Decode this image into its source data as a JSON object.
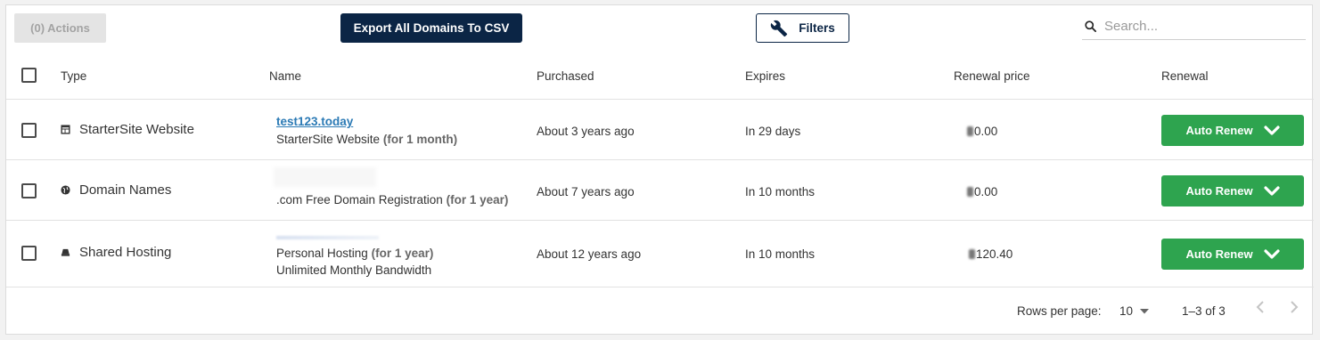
{
  "toolbar": {
    "actions_label": "(0) Actions",
    "export_label": "Export All Domains To CSV",
    "filters_label": "Filters",
    "search_placeholder": "Search..."
  },
  "table": {
    "columns": [
      "Type",
      "Name",
      "Purchased",
      "Expires",
      "Renewal price",
      "Renewal"
    ],
    "rows": [
      {
        "type": "StarterSite Website",
        "type_icon": "website-icon",
        "name_link": "test123.today",
        "name_sub": "StarterSite Website",
        "name_sub_duration": "(for 1 month)",
        "name_sub2": "",
        "purchased": "About 3 years ago",
        "expires": "In 29 days",
        "renewal_price": "0.00",
        "renewal_label": "Auto Renew"
      },
      {
        "type": "Domain Names",
        "type_icon": "globe-icon",
        "name_link": "",
        "name_sub": ".com Free Domain Registration",
        "name_sub_duration": "(for 1 year)",
        "name_sub2": "",
        "purchased": "About 7 years ago",
        "expires": "In 10 months",
        "renewal_price": "0.00",
        "renewal_label": "Auto Renew"
      },
      {
        "type": "Shared Hosting",
        "type_icon": "hosting-icon",
        "name_link": "",
        "name_sub": "Personal Hosting",
        "name_sub_duration": "(for 1 year)",
        "name_sub2": "Unlimited Monthly Bandwidth",
        "purchased": "About 12 years ago",
        "expires": "In 10 months",
        "renewal_price": "120.40",
        "renewal_label": "Auto Renew"
      }
    ]
  },
  "footer": {
    "rows_per_page_label": "Rows per page:",
    "rows_per_page_value": "10",
    "range": "1–3 of 3"
  },
  "colors": {
    "export_bg": "#0b2545",
    "renew_bg": "#2ea44f",
    "link": "#2b7ab5"
  }
}
